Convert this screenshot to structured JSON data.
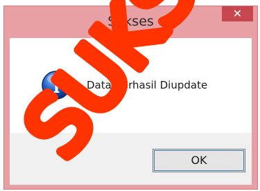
{
  "dialog": {
    "title": "Sukses",
    "close_glyph": "✕",
    "message": "Data Berhasil Diupdate",
    "icon": "info-icon",
    "ok_label": "OK"
  },
  "watermark": {
    "text": "SUKSES",
    "color": "#ff3300"
  },
  "colors": {
    "frame": "#e8a0a4",
    "close_button": "#c7474f",
    "button_bar": "#f0f0f0"
  }
}
